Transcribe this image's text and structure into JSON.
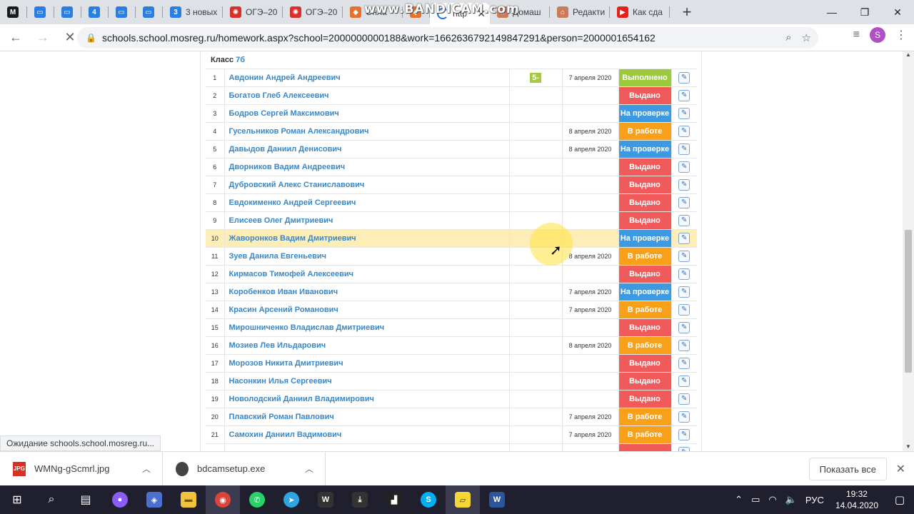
{
  "browser": {
    "tabs": [
      {
        "label": "",
        "icon": "yandex-m-icon",
        "color": "#1b1b1b",
        "glyph": "M"
      },
      {
        "label": "",
        "icon": "chat-icon",
        "color": "#2a7de1",
        "glyph": "▭"
      },
      {
        "label": "",
        "icon": "chat-icon",
        "color": "#2a7de1",
        "glyph": "▭"
      },
      {
        "label": "",
        "icon": "number-4-icon",
        "color": "#2a7de1",
        "glyph": "4"
      },
      {
        "label": "",
        "icon": "chat-icon",
        "color": "#2a7de1",
        "glyph": "▭"
      },
      {
        "label": "",
        "icon": "chat-icon",
        "color": "#2a7de1",
        "glyph": "▭"
      },
      {
        "label": "3 новых",
        "icon": "number-3-icon",
        "color": "#2a7de1",
        "glyph": "3"
      },
      {
        "label": "ОГЭ–20",
        "icon": "reshu-oge-icon",
        "color": "#d9302c",
        "glyph": "✺"
      },
      {
        "label": "ОГЭ–20",
        "icon": "reshu-oge-icon",
        "color": "#d9302c",
        "glyph": "✺"
      },
      {
        "label": "Онла",
        "icon": "fox-icon",
        "color": "#e8702a",
        "glyph": "◆"
      },
      {
        "label": "",
        "icon": "tab-icon",
        "color": "#e8702a",
        "glyph": "◆"
      },
      {
        "label": "http",
        "icon": "loading-icon",
        "color": "#ffffff",
        "glyph": ""
      },
      {
        "label": "Домаш",
        "icon": "school-icon",
        "color": "#c97b5a",
        "glyph": "⌂"
      },
      {
        "label": "Редакти",
        "icon": "school-icon",
        "color": "#c97b5a",
        "glyph": "⌂"
      },
      {
        "label": "Как сда",
        "icon": "youtube-icon",
        "color": "#e62117",
        "glyph": "▶"
      }
    ],
    "watermark": "www.BANDICAM.com",
    "url": "schools.school.mosreg.ru/homework.aspx?school=2000000000188&work=1662636792149847291&person=2000001654162",
    "avatar_letter": "S"
  },
  "page": {
    "class_prefix": "Класс",
    "class_name": "7б",
    "rows": [
      {
        "num": "1",
        "name": "Авдонин Андрей Андреевич",
        "grade": "5-",
        "date": "7 апреля 2020",
        "status": "Выполнено",
        "kind": "done"
      },
      {
        "num": "2",
        "name": "Богатов Глеб Алексеевич",
        "grade": "",
        "date": "",
        "status": "Выдано",
        "kind": "issued"
      },
      {
        "num": "3",
        "name": "Бодров Сергей Максимович",
        "grade": "",
        "date": "",
        "status": "На проверке",
        "kind": "review"
      },
      {
        "num": "4",
        "name": "Гусельников Роман Александрович",
        "grade": "",
        "date": "8 апреля 2020",
        "status": "В работе",
        "kind": "work"
      },
      {
        "num": "5",
        "name": "Давыдов Даниил Денисович",
        "grade": "",
        "date": "8 апреля 2020",
        "status": "На проверке",
        "kind": "review"
      },
      {
        "num": "6",
        "name": "Дворников Вадим Андреевич",
        "grade": "",
        "date": "",
        "status": "Выдано",
        "kind": "issued"
      },
      {
        "num": "7",
        "name": "Дубровский Алекс Станиславович",
        "grade": "",
        "date": "",
        "status": "Выдано",
        "kind": "issued"
      },
      {
        "num": "8",
        "name": "Евдокименко Андрей Сергеевич",
        "grade": "",
        "date": "",
        "status": "Выдано",
        "kind": "issued"
      },
      {
        "num": "9",
        "name": "Елисеев Олег Дмитриевич",
        "grade": "",
        "date": "",
        "status": "Выдано",
        "kind": "issued"
      },
      {
        "num": "10",
        "name": "Жаворонков Вадим Дмитриевич",
        "grade": "",
        "date": "",
        "status": "На проверке",
        "kind": "review",
        "highlight": true
      },
      {
        "num": "11",
        "name": "Зуев Данила Евгеньевич",
        "grade": "",
        "date": "8 апреля 2020",
        "status": "В работе",
        "kind": "work"
      },
      {
        "num": "12",
        "name": "Кирмасов Тимофей Алексеевич",
        "grade": "",
        "date": "",
        "status": "Выдано",
        "kind": "issued"
      },
      {
        "num": "13",
        "name": "Коробенков Иван Иванович",
        "grade": "",
        "date": "7 апреля 2020",
        "status": "На проверке",
        "kind": "review"
      },
      {
        "num": "14",
        "name": "Красин Арсений Романович",
        "grade": "",
        "date": "7 апреля 2020",
        "status": "В работе",
        "kind": "work"
      },
      {
        "num": "15",
        "name": "Мирошниченко Владислав Дмитриевич",
        "grade": "",
        "date": "",
        "status": "Выдано",
        "kind": "issued"
      },
      {
        "num": "16",
        "name": "Мозиев Лев Ильдарович",
        "grade": "",
        "date": "8 апреля 2020",
        "status": "В работе",
        "kind": "work"
      },
      {
        "num": "17",
        "name": "Морозов Никита Дмитриевич",
        "grade": "",
        "date": "",
        "status": "Выдано",
        "kind": "issued"
      },
      {
        "num": "18",
        "name": "Насонкин Илья Сергеевич",
        "grade": "",
        "date": "",
        "status": "Выдано",
        "kind": "issued"
      },
      {
        "num": "19",
        "name": "Новолодский Даниил Владимирович",
        "grade": "",
        "date": "",
        "status": "Выдано",
        "kind": "issued"
      },
      {
        "num": "20",
        "name": "Плавский Роман Павлович",
        "grade": "",
        "date": "7 апреля 2020",
        "status": "В работе",
        "kind": "work"
      },
      {
        "num": "21",
        "name": "Самохин Даниил Вадимович",
        "grade": "",
        "date": "7 апреля 2020",
        "status": "В работе",
        "kind": "work"
      },
      {
        "num": "",
        "name": "",
        "grade": "",
        "date": "",
        "status": "",
        "kind": "issued"
      }
    ],
    "status_colors": {
      "done": "#9bcb3c",
      "issued": "#f05a5a",
      "review": "#3d9ae0",
      "work": "#f7a11a"
    }
  },
  "status_tip": "Ожидание schools.school.mosreg.ru...",
  "downloads": {
    "items": [
      {
        "name": "WMNg-gScmrl.jpg",
        "icon": "jpg-file-icon",
        "badge": "JPG",
        "color": "#d93025"
      },
      {
        "name": "bdcamsetup.exe",
        "icon": "exe-file-icon",
        "badge": "",
        "color": "#444444"
      }
    ],
    "show_all": "Показать все"
  },
  "taskbar": {
    "lang": "РУС",
    "time": "19:32",
    "date": "14.04.2020"
  }
}
